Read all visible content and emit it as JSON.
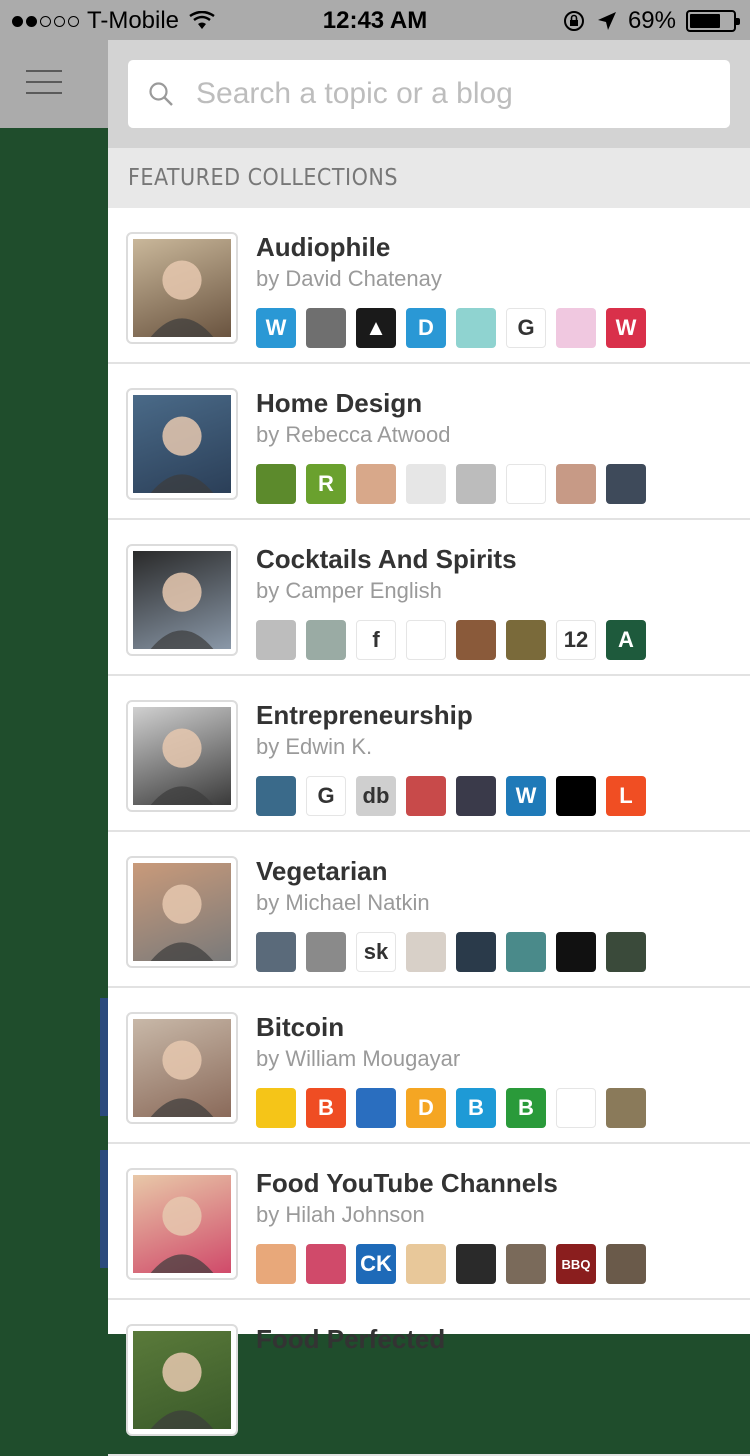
{
  "status_bar": {
    "carrier": "T-Mobile",
    "time": "12:43 AM",
    "battery": "69%"
  },
  "search": {
    "placeholder": "Search a topic or a blog"
  },
  "section_title": "FEATURED COLLECTIONS",
  "collections": [
    {
      "title": "Audiophile",
      "author": "by David Chatenay",
      "avatar_colors": [
        "#c9b79a",
        "#6a5440"
      ],
      "icons": [
        {
          "label": "W",
          "color": "#2a98d5"
        },
        {
          "label": "",
          "color": "#6f6f6f"
        },
        {
          "label": "▲",
          "color": "#1a1a1a"
        },
        {
          "label": "D",
          "color": "#2a98d5"
        },
        {
          "label": "",
          "color": "#8fd3d0"
        },
        {
          "label": "G",
          "color": "#ffffff"
        },
        {
          "label": "",
          "color": "#f0c8e0"
        },
        {
          "label": "W",
          "color": "#d9304a"
        }
      ]
    },
    {
      "title": "Home Design",
      "author": "by Rebecca Atwood",
      "avatar_colors": [
        "#4a6a88",
        "#2b3f58"
      ],
      "icons": [
        {
          "label": "",
          "color": "#5c8a2c"
        },
        {
          "label": "R",
          "color": "#6aa12e"
        },
        {
          "label": "",
          "color": "#d8a88a"
        },
        {
          "label": "",
          "color": "#e6e6e6"
        },
        {
          "label": "",
          "color": "#bcbcbc"
        },
        {
          "label": "",
          "color": "#ffffff"
        },
        {
          "label": "",
          "color": "#c79a86"
        },
        {
          "label": "",
          "color": "#3e4a5a"
        }
      ]
    },
    {
      "title": "Cocktails And Spirits",
      "author": "by Camper English",
      "avatar_colors": [
        "#2a2a2a",
        "#8a98a8"
      ],
      "icons": [
        {
          "label": "",
          "color": "#bdbdbd"
        },
        {
          "label": "",
          "color": "#9aaba4"
        },
        {
          "label": "f",
          "color": "#ffffff"
        },
        {
          "label": "",
          "color": "#ffffff"
        },
        {
          "label": "",
          "color": "#8a5a3a"
        },
        {
          "label": "",
          "color": "#7a6a3a"
        },
        {
          "label": "12",
          "color": "#ffffff"
        },
        {
          "label": "A",
          "color": "#1e5a3c"
        }
      ]
    },
    {
      "title": "Entrepreneurship",
      "author": "by Edwin K.",
      "avatar_colors": [
        "#d0d0d0",
        "#3a3a3a"
      ],
      "icons": [
        {
          "label": "",
          "color": "#3a6a8a"
        },
        {
          "label": "G",
          "color": "#ffffff"
        },
        {
          "label": "db",
          "color": "#cfcfcf"
        },
        {
          "label": "",
          "color": "#c84a4a"
        },
        {
          "label": "",
          "color": "#3a3a4a"
        },
        {
          "label": "W",
          "color": "#1f7ab8"
        },
        {
          "label": "",
          "color": "#000000"
        },
        {
          "label": "L",
          "color": "#f04e23"
        }
      ]
    },
    {
      "title": "Vegetarian",
      "author": "by Michael Natkin",
      "avatar_colors": [
        "#c99a7a",
        "#7a7a7a"
      ],
      "icons": [
        {
          "label": "",
          "color": "#5a6a7a"
        },
        {
          "label": "",
          "color": "#8a8a8a"
        },
        {
          "label": "sk",
          "color": "#ffffff"
        },
        {
          "label": "",
          "color": "#d8d0c8"
        },
        {
          "label": "",
          "color": "#2a3a4a"
        },
        {
          "label": "",
          "color": "#4a8a8a"
        },
        {
          "label": "",
          "color": "#111111"
        },
        {
          "label": "",
          "color": "#3a4a3a"
        }
      ]
    },
    {
      "title": "Bitcoin",
      "author": "by William Mougayar",
      "avatar_colors": [
        "#c8b8a8",
        "#8a6a5a"
      ],
      "icons": [
        {
          "label": "",
          "color": "#f5c518"
        },
        {
          "label": "B",
          "color": "#ef4d23"
        },
        {
          "label": "",
          "color": "#2a6ebf"
        },
        {
          "label": "D",
          "color": "#f5a623"
        },
        {
          "label": "B",
          "color": "#1e9ad6"
        },
        {
          "label": "B",
          "color": "#2a9a3a"
        },
        {
          "label": "",
          "color": "#ffffff"
        },
        {
          "label": "",
          "color": "#8a7a5a"
        }
      ]
    },
    {
      "title": "Food YouTube Channels",
      "author": "by Hilah Johnson",
      "avatar_colors": [
        "#e8c8a8",
        "#d04a6a"
      ],
      "icons": [
        {
          "label": "",
          "color": "#e8a87a"
        },
        {
          "label": "",
          "color": "#d04a6a"
        },
        {
          "label": "CK",
          "color": "#1e6ab8"
        },
        {
          "label": "",
          "color": "#e8c89a"
        },
        {
          "label": "",
          "color": "#2a2a2a"
        },
        {
          "label": "",
          "color": "#7a6a5a"
        },
        {
          "label": "BBQ",
          "color": "#8a1e1e"
        },
        {
          "label": "",
          "color": "#6a5a4a"
        }
      ]
    },
    {
      "title": "Food Perfected",
      "author": "",
      "avatar_colors": [
        "#5a7a3a",
        "#3a5a2a"
      ],
      "icons": []
    }
  ]
}
